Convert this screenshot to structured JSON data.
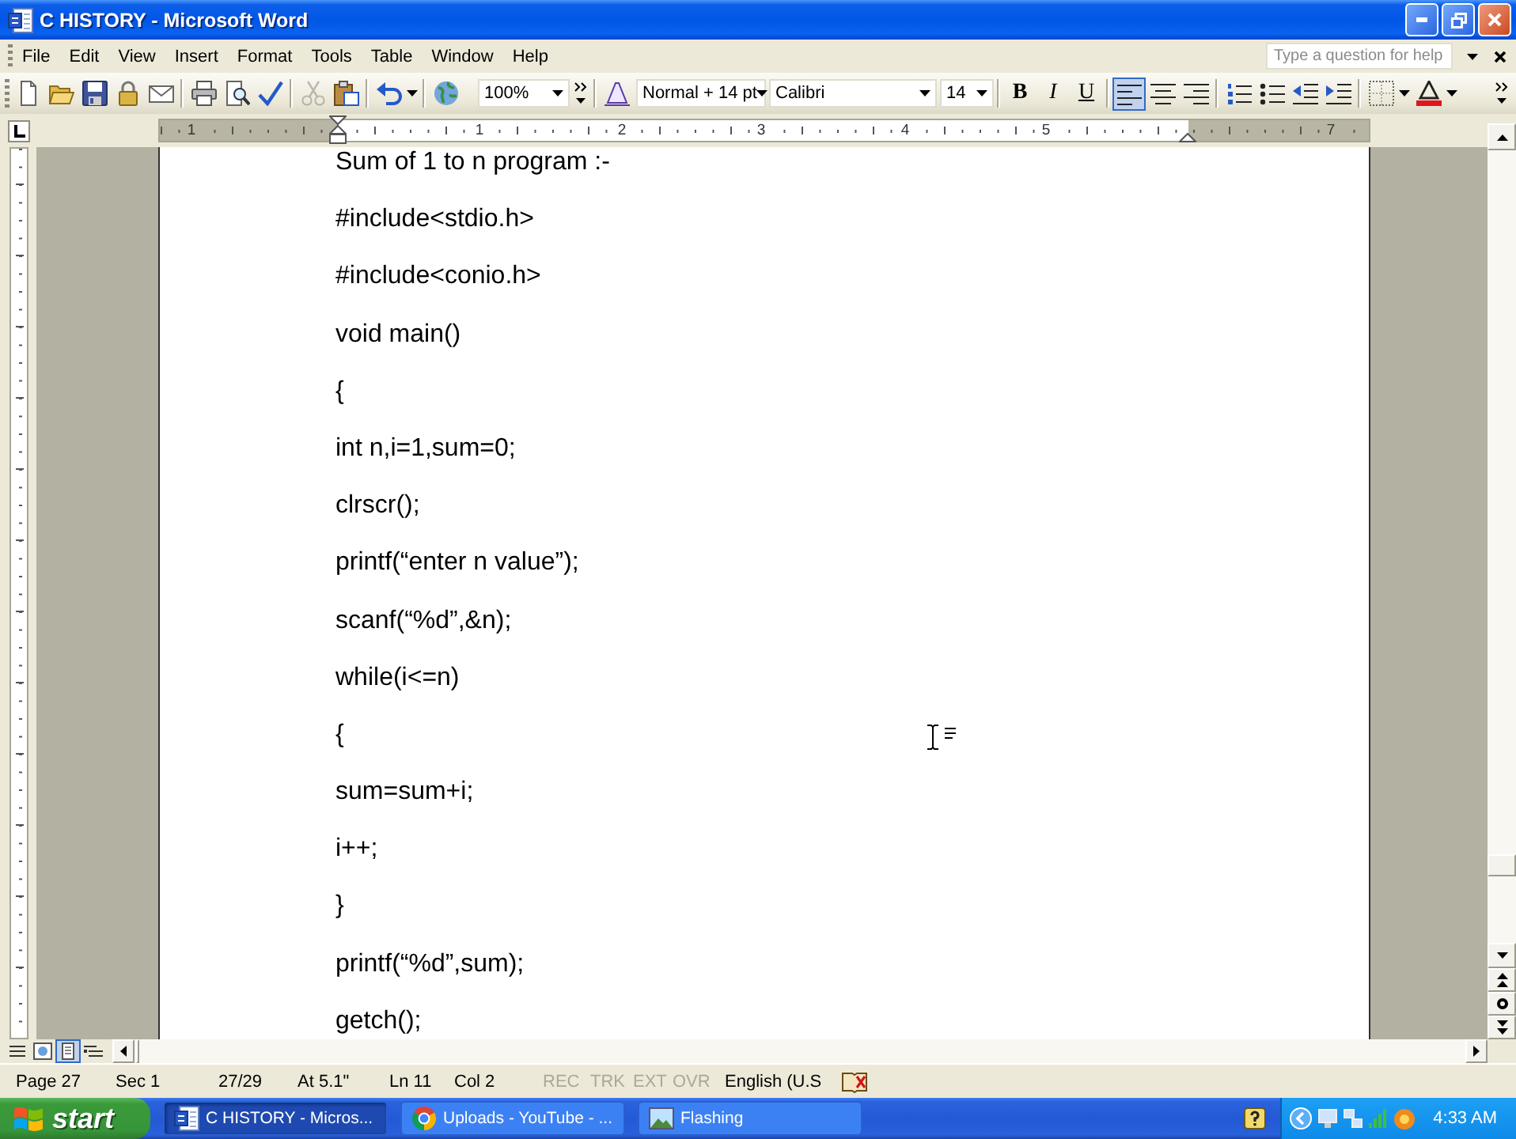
{
  "window": {
    "title": "C HISTORY - Microsoft Word"
  },
  "menu_bar": {
    "items": [
      "File",
      "Edit",
      "View",
      "Insert",
      "Format",
      "Tools",
      "Table",
      "Window",
      "Help"
    ],
    "help_field": {
      "placeholder": "Type a question for help"
    }
  },
  "standard_toolbar": {
    "groups": [
      [
        {
          "kind": "new",
          "disabled": false
        },
        {
          "kind": "open",
          "disabled": false
        },
        {
          "kind": "save",
          "disabled": false
        },
        {
          "kind": "permission",
          "disabled": false
        },
        {
          "kind": "email",
          "disabled": false
        }
      ],
      [
        {
          "kind": "print",
          "disabled": false
        },
        {
          "kind": "preview",
          "disabled": false
        },
        {
          "kind": "spelling",
          "disabled": false
        }
      ],
      [
        {
          "kind": "cut",
          "disabled": true
        },
        {
          "kind": "paste",
          "disabled": false
        }
      ],
      [
        {
          "kind": "undo",
          "disabled": false
        }
      ],
      [
        {
          "kind": "hyperlink",
          "disabled": false
        }
      ]
    ],
    "zoom": "100%"
  },
  "formatting_toolbar": {
    "style": "Normal + 14 pt",
    "font": "Calibri",
    "size": "14",
    "bold": "B",
    "italic": "I",
    "underline": "U",
    "alignment": [
      {
        "kind": "left",
        "selected": true
      },
      {
        "kind": "center",
        "selected": false
      },
      {
        "kind": "right",
        "selected": false
      }
    ]
  },
  "ruler": {
    "labels": [
      "1",
      "1",
      "2",
      "3",
      "4",
      "5",
      "7"
    ]
  },
  "document": {
    "lines": [
      "Sum of 1 to n program :-",
      "#include<stdio.h>",
      "#include<conio.h>",
      "void main()",
      "{",
      "int n,i=1,sum=0;",
      "clrscr();",
      "printf(“enter n value”);",
      "scanf(“%d”,&n);",
      "while(i<=n)",
      "{",
      "sum=sum+i;",
      "i++;",
      "}",
      "printf(“%d”,sum);",
      "getch();"
    ]
  },
  "view_buttons": [
    {
      "kind": "normal",
      "selected": false
    },
    {
      "kind": "web",
      "selected": false
    },
    {
      "kind": "print",
      "selected": true
    },
    {
      "kind": "outline",
      "selected": false
    }
  ],
  "status_bar": {
    "page": "Page 27",
    "section": "Sec 1",
    "pages": "27/29",
    "position": "At 5.1\"",
    "line": "Ln 11",
    "column": "Col 2",
    "modes": [
      {
        "label": "REC",
        "on": false
      },
      {
        "label": "TRK",
        "on": false
      },
      {
        "label": "EXT",
        "on": false
      },
      {
        "label": "OVR",
        "on": false
      }
    ],
    "language": "English (U.S"
  },
  "taskbar": {
    "start": "start",
    "tasks": [
      {
        "kind": "document",
        "label": "C HISTORY - Micros...",
        "selected": true
      },
      {
        "kind": "browser",
        "label": "Uploads - YouTube - ...",
        "selected": false
      },
      {
        "kind": "picture",
        "label": "Flashing",
        "selected": false
      }
    ],
    "clock": "4:33 AM"
  }
}
